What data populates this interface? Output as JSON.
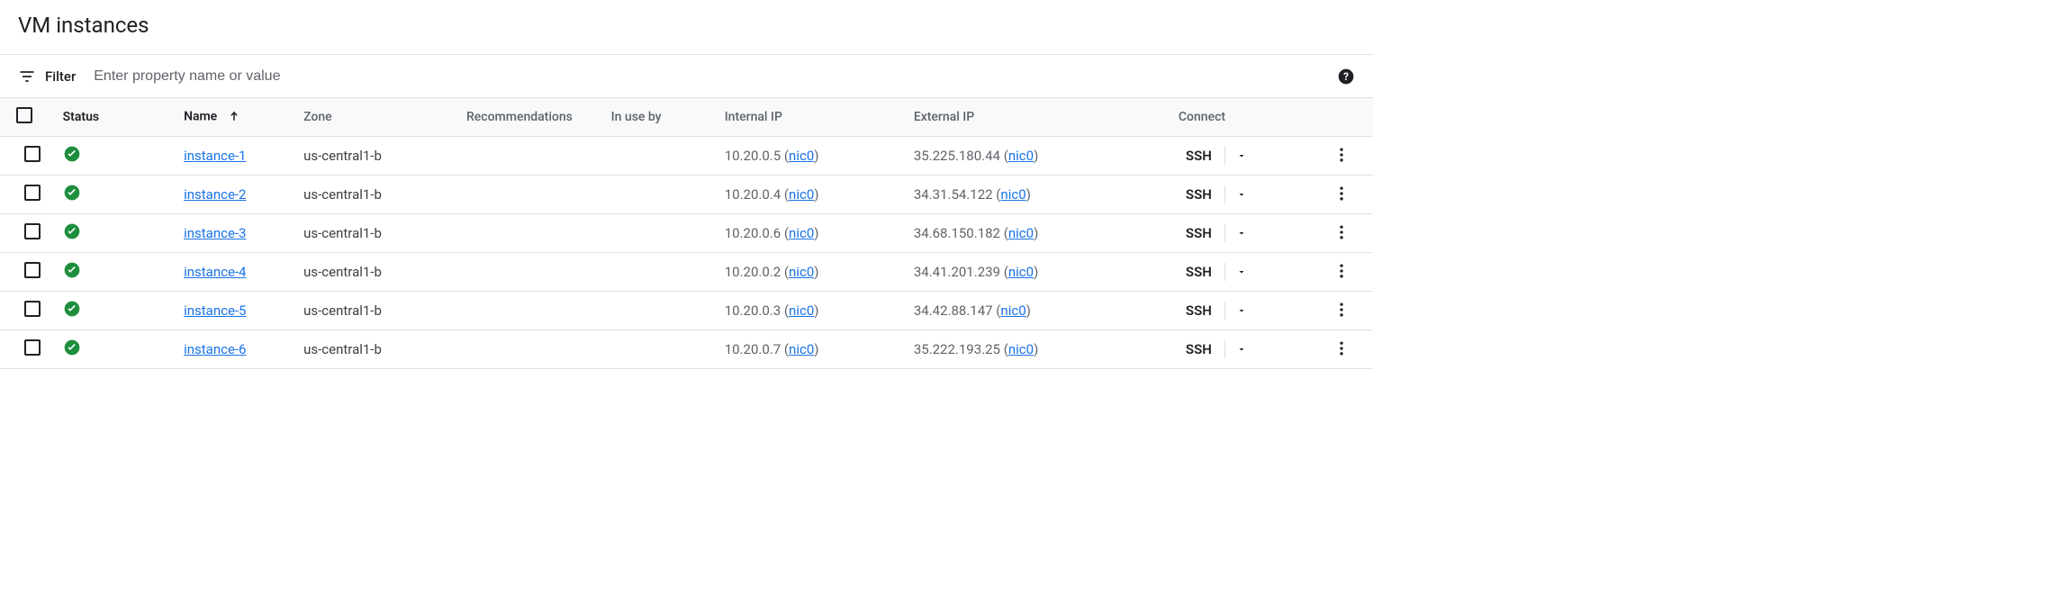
{
  "page": {
    "title": "VM instances"
  },
  "filter": {
    "label": "Filter",
    "placeholder": "Enter property name or value"
  },
  "columns": {
    "status": "Status",
    "name": "Name",
    "zone": "Zone",
    "recommendations": "Recommendations",
    "in_use_by": "In use by",
    "internal_ip": "Internal IP",
    "external_ip": "External IP",
    "connect": "Connect"
  },
  "buttons": {
    "ssh": "SSH"
  },
  "nic_label": "nic0",
  "rows": [
    {
      "name": "instance-1",
      "zone": "us-central1-b",
      "internal_ip": "10.20.0.5",
      "external_ip": "35.225.180.44"
    },
    {
      "name": "instance-2",
      "zone": "us-central1-b",
      "internal_ip": "10.20.0.4",
      "external_ip": "34.31.54.122"
    },
    {
      "name": "instance-3",
      "zone": "us-central1-b",
      "internal_ip": "10.20.0.6",
      "external_ip": "34.68.150.182"
    },
    {
      "name": "instance-4",
      "zone": "us-central1-b",
      "internal_ip": "10.20.0.2",
      "external_ip": "34.41.201.239"
    },
    {
      "name": "instance-5",
      "zone": "us-central1-b",
      "internal_ip": "10.20.0.3",
      "external_ip": "34.42.88.147"
    },
    {
      "name": "instance-6",
      "zone": "us-central1-b",
      "internal_ip": "10.20.0.7",
      "external_ip": "35.222.193.25"
    }
  ]
}
